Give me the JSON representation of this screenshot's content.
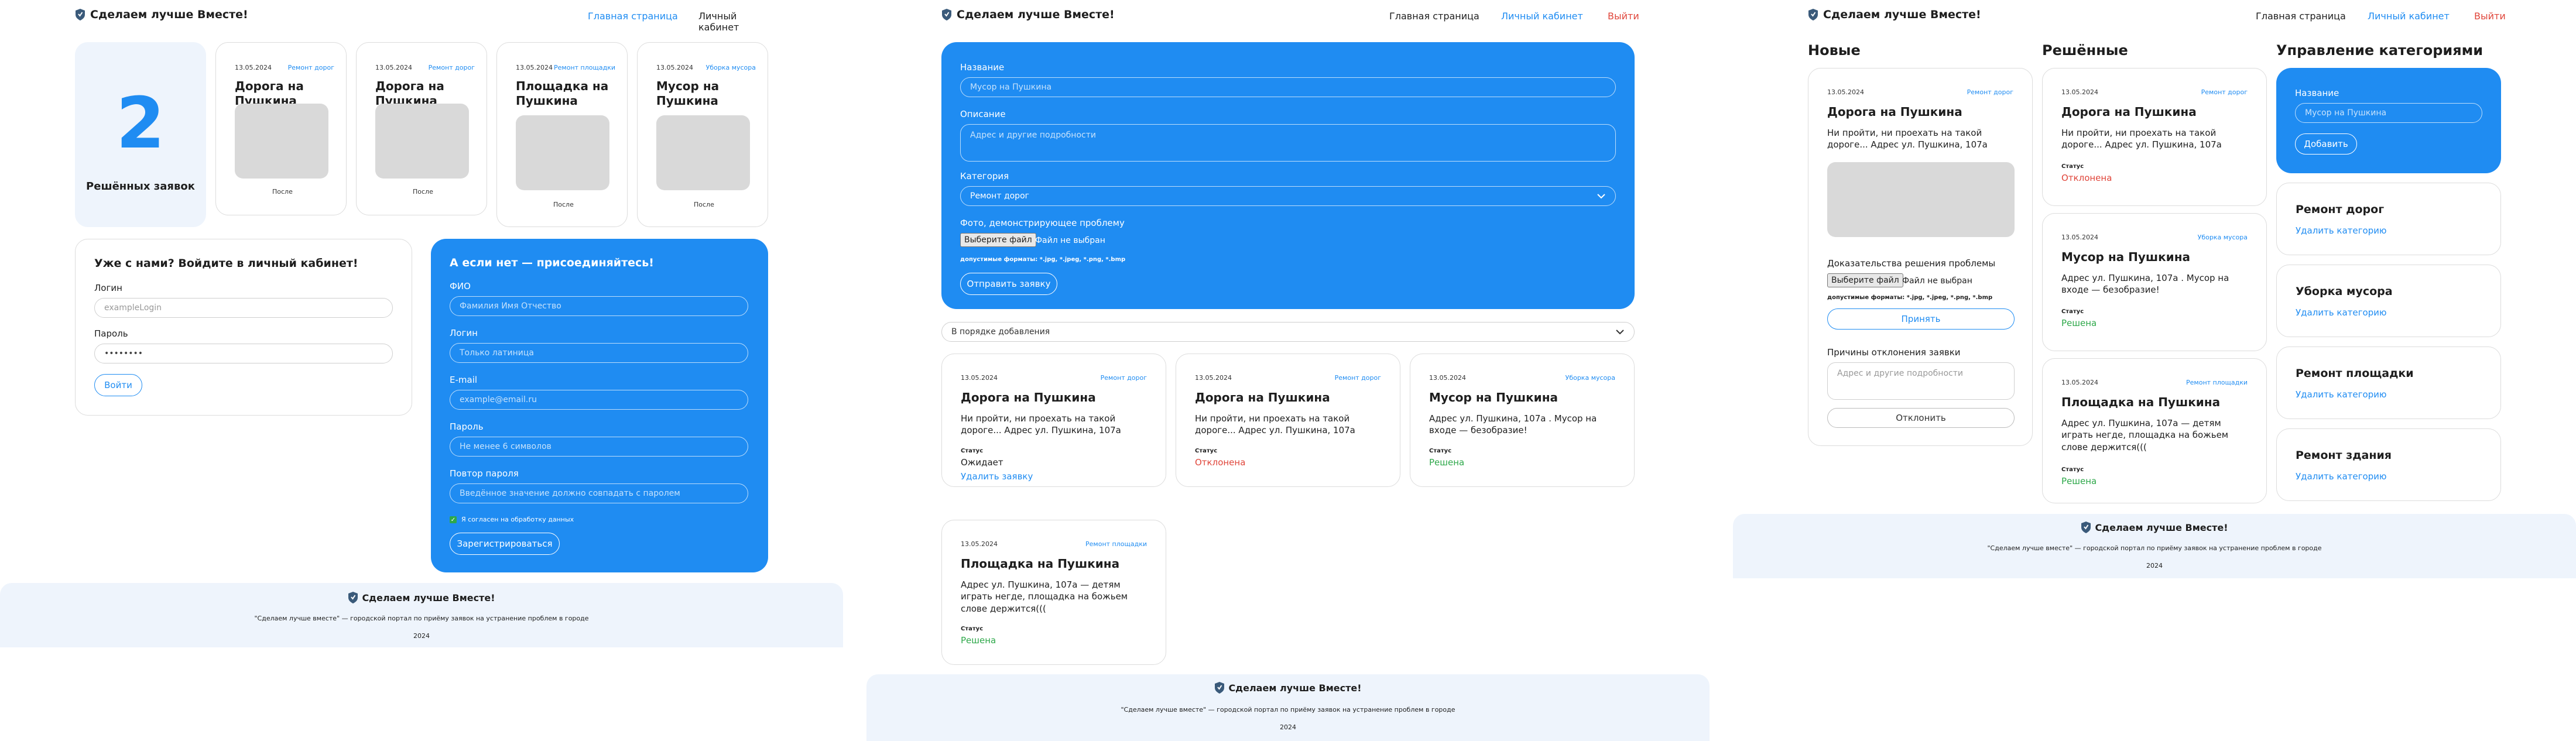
{
  "brand": "Сделаем лучше Вместе!",
  "colors": {
    "accent": "#1f8cf2",
    "danger": "#e0453a",
    "success": "#2ea84a",
    "footer": "#eef4fc"
  },
  "p1": {
    "nav": {
      "home": "Главная страница",
      "cabinet": "Личный кабинет"
    },
    "counter": {
      "number": "2",
      "label": "Решённых заявок"
    },
    "cards": [
      {
        "date": "13.05.2024",
        "category": "Ремонт дорог",
        "title": "Дорога на Пушкина",
        "caption": "После"
      },
      {
        "date": "13.05.2024",
        "category": "Ремонт дорог",
        "title": "Дорога на Пушкина",
        "caption": "После"
      },
      {
        "date": "13.05.2024",
        "category": "Ремонт площадки",
        "title": "Площадка на Пушкина",
        "caption": "После"
      },
      {
        "date": "13.05.2024",
        "category": "Уборка мусора",
        "title": "Мусор на Пушкина",
        "caption": "После"
      }
    ],
    "login": {
      "heading": "Уже с нами? Войдите в личный кабинет!",
      "login_label": "Логин",
      "login_placeholder": "exampleLogin",
      "password_label": "Пароль",
      "password_value": "••••••••",
      "button": "Войти"
    },
    "register": {
      "heading": "А если нет — присоединяйтесь!",
      "fio_label": "ФИО",
      "fio_placeholder": "Фамилия Имя Отчество",
      "login_label": "Логин",
      "login_placeholder": "Только латиница",
      "email_label": "E-mail",
      "email_placeholder": "example@email.ru",
      "password_label": "Пароль",
      "password_placeholder": "Не менее 6 символов",
      "repeat_label": "Повтор пароля",
      "repeat_placeholder": "Введённое значение должно совпадать с паролем",
      "consent": "Я согласен на обработку данных",
      "button": "Зарегистрироваться"
    }
  },
  "p2": {
    "nav": {
      "home": "Главная страница",
      "cabinet": "Личный кабинет",
      "logout": "Выйти"
    },
    "form": {
      "name_label": "Название",
      "name_placeholder": "Мусор на Пушкина",
      "desc_label": "Описание",
      "desc_placeholder": "Адрес и другие подробности",
      "cat_label": "Категория",
      "cat_value": "Ремонт дорог",
      "photo_label": "Фото, демонстрирующее проблему",
      "file_button": "Выберите файл",
      "file_status": "Файл не выбран",
      "formats": "допустимые форматы: *.jpg, *.jpeg, *.png, *.bmp",
      "submit": "Отправить заявку"
    },
    "sort": "В порядке добавления",
    "cards": [
      {
        "date": "13.05.2024",
        "category": "Ремонт дорог",
        "title": "Дорога на Пушкина",
        "text": "Ни пройти, ни проехать на такой дороге... Адрес ул. Пушкина, 107а",
        "status_label": "Статус",
        "status": "Ожидает",
        "delete": "Удалить заявку"
      },
      {
        "date": "13.05.2024",
        "category": "Ремонт дорог",
        "title": "Дорога на Пушкина",
        "text": "Ни пройти, ни проехать на такой дороге... Адрес ул. Пушкина, 107а",
        "status_label": "Статус",
        "status": "Отклонена"
      },
      {
        "date": "13.05.2024",
        "category": "Уборка мусора",
        "title": "Мусор на Пушкина",
        "text": "Адрес ул. Пушкина, 107а . Мусор на входе — безобразие!",
        "status_label": "Статус",
        "status": "Решена"
      },
      {
        "date": "13.05.2024",
        "category": "Ремонт площадки",
        "title": "Площадка на Пушкина",
        "text": "Адрес ул. Пушкина, 107а — детям играть негде, площадка на божьем слове держится(((",
        "status_label": "Статус",
        "status": "Решена"
      }
    ]
  },
  "p3": {
    "nav": {
      "home": "Главная страница",
      "cabinet": "Личный кабинет",
      "logout": "Выйти"
    },
    "col_new": "Новые",
    "col_solved": "Решённые",
    "col_cats": "Управление категориями",
    "new_card": {
      "date": "13.05.2024",
      "category": "Ремонт дорог",
      "title": "Дорога на Пушкина",
      "text": "Ни пройти, ни проехать на такой дороге... Адрес ул. Пушкина, 107а",
      "proof_label": "Доказательства решения проблемы",
      "file_button": "Выберите файл",
      "file_status": "Файл не выбран",
      "formats": "допустимые форматы: *.jpg, *.jpeg, *.png, *.bmp",
      "accept": "Принять",
      "reason_label": "Причины отклонения заявки",
      "reason_placeholder": "Адрес и другие подробности",
      "reject": "Отклонить"
    },
    "solved": [
      {
        "date": "13.05.2024",
        "category": "Ремонт дорог",
        "title": "Дорога на Пушкина",
        "text": "Ни пройти, ни проехать на такой дороге... Адрес ул. Пушкина, 107а",
        "status_label": "Статус",
        "status": "Отклонена"
      },
      {
        "date": "13.05.2024",
        "category": "Уборка мусора",
        "title": "Мусор на Пушкина",
        "text": "Адрес ул. Пушкина, 107а . Мусор на входе — безобразие!",
        "status_label": "Статус",
        "status": "Решена"
      },
      {
        "date": "13.05.2024",
        "category": "Ремонт площадки",
        "title": "Площадка на Пушкина",
        "text": "Адрес ул. Пушкина, 107а — детям играть негде, площадка на божьем слове держится(((",
        "status_label": "Статус",
        "status": "Решена"
      }
    ],
    "add_cat": {
      "label": "Название",
      "placeholder": "Мусор на Пушкина",
      "button": "Добавить"
    },
    "categories": [
      {
        "name": "Ремонт дорог",
        "delete": "Удалить категорию"
      },
      {
        "name": "Уборка мусора",
        "delete": "Удалить категорию"
      },
      {
        "name": "Ремонт площадки",
        "delete": "Удалить категорию"
      },
      {
        "name": "Ремонт здания",
        "delete": "Удалить категорию"
      }
    ]
  },
  "footer": {
    "brand": "Сделаем лучше Вместе!",
    "text": "\"Сделаем лучше вместе\" — городской портал по приёму заявок на устранение проблем в городе",
    "year": "2024"
  }
}
